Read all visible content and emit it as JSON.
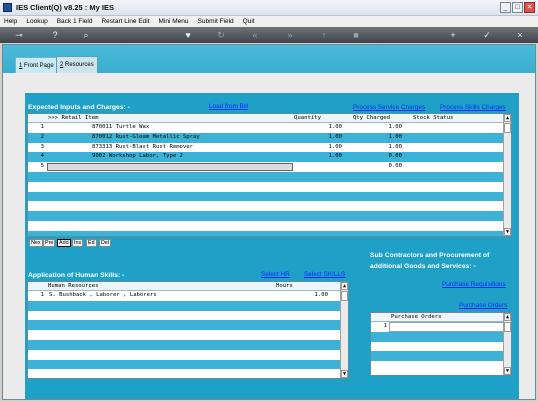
{
  "window": {
    "title": "IES Client(Q) v8.25 : My IES"
  },
  "menu": [
    "Help",
    "Lookup",
    "Back 1 Field",
    "Restart Line Edit",
    "Mini Menu",
    "Submit Field",
    "Quit"
  ],
  "toolbar_icons": [
    "key-icon",
    "help-icon",
    "search-icon",
    "heart-icon",
    "refresh-icon",
    "rewind-icon",
    "fast-forward-icon",
    "upload-icon",
    "stop-icon",
    "add-icon",
    "check-icon",
    "close-icon"
  ],
  "tabs": [
    {
      "num": "1",
      "label": " Front Page"
    },
    {
      "num": "2",
      "label": " Resources"
    }
  ],
  "expected": {
    "title": "Expected Inputs and Charges: -",
    "load_link": "Load from Bill",
    "process_service_link": "Process Service Charges",
    "process_skills_link": "Process Skills Charges",
    "headers": [
      ">>> Retail Item",
      "Quantity",
      "Qty Charged",
      "Stock Status"
    ],
    "rows": [
      {
        "n": "1",
        "item": "870011 Turtle Wax",
        "qty": "1.00",
        "charged": "1.00"
      },
      {
        "n": "2",
        "item": "870012 Rust-Gleam Metallic Spray",
        "qty": "1.00",
        "charged": "1.00"
      },
      {
        "n": "3",
        "item": "873313 Rust-Blast Rust Remover",
        "qty": "1.00",
        "charged": "1.00"
      },
      {
        "n": "4",
        "item": "9002 Workshop Labor, Type 2",
        "qty": "1.00",
        "charged": "0.00"
      },
      {
        "n": "5",
        "item": "",
        "qty": "",
        "charged": "0.00"
      }
    ],
    "nav": [
      "Nex",
      "Pre",
      "Add",
      "Ins",
      "Ed",
      "Del"
    ]
  },
  "skills": {
    "title": "Application of Human Skills: -",
    "select_hr": "Select HR",
    "select_skills": "Select SKILLS",
    "headers": [
      "Human Resources",
      "Hours"
    ],
    "rows": [
      {
        "n": "1",
        "text": "S. Bushback    , Laborer     , Laborers",
        "hours": "1.00"
      }
    ]
  },
  "subcontract": {
    "title_line1": "Sub Contractors and Procurement of",
    "title_line2": "additional Goods and Services: -",
    "requisitions_link": "Purchase Requisitions",
    "orders_link": "Purchase Orders",
    "headers": [
      "Purchase Orders"
    ],
    "rows": [
      {
        "n": "1"
      }
    ]
  },
  "side_letter": "E",
  "colors": {
    "accent_blue": "#1fa1c7",
    "row_blue": "#3cb3d6",
    "link": "#0a2cff"
  }
}
